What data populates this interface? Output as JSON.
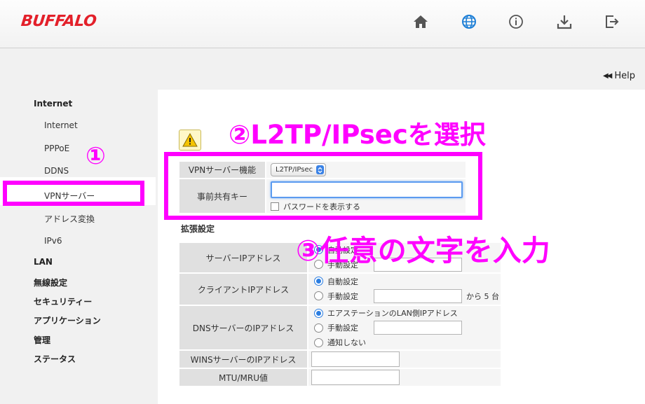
{
  "header": {
    "logo": "BUFFALO",
    "icons": [
      "home-icon",
      "globe-icon",
      "info-icon",
      "download-icon",
      "logout-icon"
    ]
  },
  "help": {
    "label": "Help"
  },
  "sidebar": {
    "items": [
      {
        "label": "Internet",
        "level": "top"
      },
      {
        "label": "Internet",
        "level": "sub"
      },
      {
        "label": "PPPoE",
        "level": "sub"
      },
      {
        "label": "DDNS",
        "level": "sub"
      },
      {
        "label": "VPNサーバー",
        "level": "sub",
        "active": true
      },
      {
        "label": "アドレス変換",
        "level": "sub"
      },
      {
        "label": "IPv6",
        "level": "sub"
      },
      {
        "label": "LAN",
        "level": "top"
      },
      {
        "label": "無線設定",
        "level": "top"
      },
      {
        "label": "セキュリティー",
        "level": "top"
      },
      {
        "label": "アプリケーション",
        "level": "top"
      },
      {
        "label": "管理",
        "level": "top"
      },
      {
        "label": "ステータス",
        "level": "top"
      }
    ]
  },
  "vpn": {
    "function_label": "VPNサーバー機能",
    "function_value": "L2TP/IPsec",
    "psk_label": "事前共有キー",
    "psk_value": "",
    "show_password_label": "パスワードを表示する"
  },
  "extended": {
    "title": "拡張設定",
    "server_ip": {
      "label": "サーバーIPアドレス",
      "opt_auto": "自動設定",
      "opt_manual": "手動設定"
    },
    "client_ip": {
      "label": "クライアントIPアドレス",
      "opt_auto": "自動設定",
      "opt_manual": "手動設定",
      "suffix": "から 5 台"
    },
    "dns_ip": {
      "label": "DNSサーバーのIPアドレス",
      "opt_lan": "エアステーションのLAN側IPアドレス",
      "opt_manual": "手動設定",
      "opt_none": "通知しない"
    },
    "wins_ip": {
      "label": "WINSサーバーのIPアドレス"
    },
    "mtu": {
      "label": "MTU/MRU値"
    }
  },
  "annotations": {
    "step1": "①",
    "step2": "②L2TP/IPsecを選択",
    "step3": "③任意の文字を入力",
    "color": "#ff00ff"
  },
  "colors": {
    "brand": "#e3202a",
    "globe": "#1e7fd6",
    "radio": "#2a7de1"
  }
}
